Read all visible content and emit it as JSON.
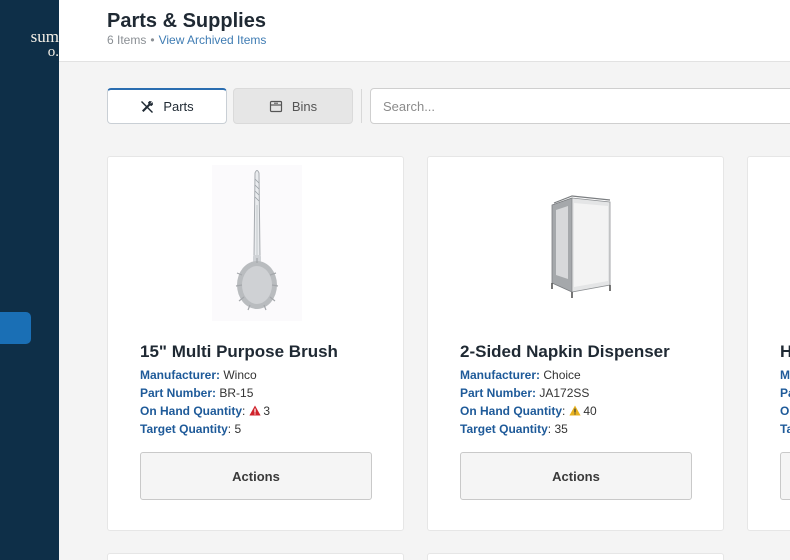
{
  "sidebar": {
    "brand_line1": "sum",
    "brand_line2": "o."
  },
  "header": {
    "title": "Parts & Supplies",
    "item_count": "6 Items",
    "separator": "•",
    "archived_link": "View Archived Items"
  },
  "toolbar": {
    "parts_label": "Parts",
    "bins_label": "Bins",
    "search_placeholder": "Search..."
  },
  "cards": [
    {
      "name": "15\" Multi Purpose Brush",
      "manufacturer_label": "Manufacturer:",
      "manufacturer": "Winco",
      "part_number_label": "Part Number:",
      "part_number": "BR-15",
      "on_hand_label": "On Hand Quantity",
      "on_hand": "3",
      "on_hand_warning": "red",
      "target_label": "Target Quantity",
      "target": "5",
      "actions_label": "Actions"
    },
    {
      "name": "2-Sided Napkin Dispenser",
      "manufacturer_label": "Manufacturer:",
      "manufacturer": "Choice",
      "part_number_label": "Part Number:",
      "part_number": "JA172SS",
      "on_hand_label": "On Hand Quantity",
      "on_hand": "40",
      "on_hand_warning": "yellow",
      "target_label": "Target Quantity",
      "target": "35",
      "actions_label": "Actions"
    },
    {
      "name": "H",
      "manufacturer_label": "Ma",
      "part_number_label": "Pa",
      "on_hand_label": "On",
      "target_label": "Ta"
    }
  ],
  "colors": {
    "sidebar_bg": "#0e2f48",
    "accent": "#1a6fb5",
    "label_blue": "#1e5a99",
    "warning_red": "#d0232b",
    "warning_yellow": "#e8b21f"
  }
}
